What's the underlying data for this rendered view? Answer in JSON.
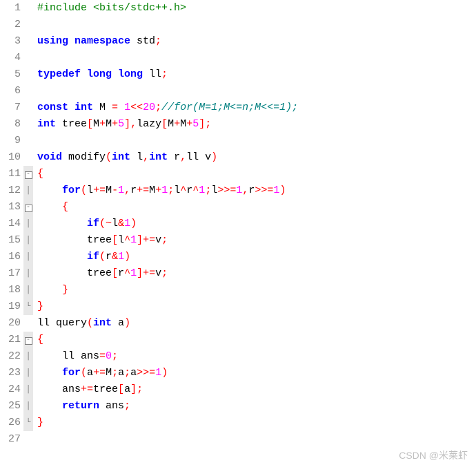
{
  "watermark": "CSDN @米莱虾",
  "lines": [
    {
      "n": 1,
      "fold": "",
      "tokens": [
        [
          "pre",
          "#include <bits/stdc++.h>"
        ]
      ]
    },
    {
      "n": 2,
      "fold": "",
      "tokens": []
    },
    {
      "n": 3,
      "fold": "",
      "tokens": [
        [
          "kw",
          "using namespace"
        ],
        [
          "plain",
          " std"
        ],
        [
          "op",
          ";"
        ]
      ]
    },
    {
      "n": 4,
      "fold": "",
      "tokens": []
    },
    {
      "n": 5,
      "fold": "",
      "tokens": [
        [
          "kw",
          "typedef long long"
        ],
        [
          "plain",
          " ll"
        ],
        [
          "op",
          ";"
        ]
      ]
    },
    {
      "n": 6,
      "fold": "",
      "tokens": []
    },
    {
      "n": 7,
      "fold": "",
      "tokens": [
        [
          "kw",
          "const int"
        ],
        [
          "plain",
          " M "
        ],
        [
          "op",
          "="
        ],
        [
          "plain",
          " "
        ],
        [
          "num",
          "1"
        ],
        [
          "op",
          "<<"
        ],
        [
          "num",
          "20"
        ],
        [
          "op",
          ";"
        ],
        [
          "cmt",
          "//for(M=1;M<=n;M<<=1);"
        ]
      ]
    },
    {
      "n": 8,
      "fold": "",
      "tokens": [
        [
          "kw",
          "int"
        ],
        [
          "plain",
          " tree"
        ],
        [
          "op",
          "["
        ],
        [
          "plain",
          "M"
        ],
        [
          "op",
          "+"
        ],
        [
          "plain",
          "M"
        ],
        [
          "op",
          "+"
        ],
        [
          "num",
          "5"
        ],
        [
          "op",
          "],"
        ],
        [
          "plain",
          "lazy"
        ],
        [
          "op",
          "["
        ],
        [
          "plain",
          "M"
        ],
        [
          "op",
          "+"
        ],
        [
          "plain",
          "M"
        ],
        [
          "op",
          "+"
        ],
        [
          "num",
          "5"
        ],
        [
          "op",
          "];"
        ]
      ]
    },
    {
      "n": 9,
      "fold": "",
      "tokens": []
    },
    {
      "n": 10,
      "fold": "",
      "tokens": [
        [
          "kw",
          "void"
        ],
        [
          "plain",
          " modify"
        ],
        [
          "op",
          "("
        ],
        [
          "kw",
          "int"
        ],
        [
          "plain",
          " l"
        ],
        [
          "op",
          ","
        ],
        [
          "kw",
          "int"
        ],
        [
          "plain",
          " r"
        ],
        [
          "op",
          ","
        ],
        [
          "plain",
          "ll v"
        ],
        [
          "op",
          ")"
        ]
      ]
    },
    {
      "n": 11,
      "fold": "box",
      "tokens": [
        [
          "op",
          "{"
        ]
      ]
    },
    {
      "n": 12,
      "fold": "│",
      "tokens": [
        [
          "plain",
          "    "
        ],
        [
          "kw",
          "for"
        ],
        [
          "op",
          "("
        ],
        [
          "plain",
          "l"
        ],
        [
          "op",
          "+="
        ],
        [
          "plain",
          "M"
        ],
        [
          "op",
          "-"
        ],
        [
          "num",
          "1"
        ],
        [
          "op",
          ","
        ],
        [
          "plain",
          "r"
        ],
        [
          "op",
          "+="
        ],
        [
          "plain",
          "M"
        ],
        [
          "op",
          "+"
        ],
        [
          "num",
          "1"
        ],
        [
          "op",
          ";"
        ],
        [
          "plain",
          "l"
        ],
        [
          "op",
          "^"
        ],
        [
          "plain",
          "r"
        ],
        [
          "op",
          "^"
        ],
        [
          "num",
          "1"
        ],
        [
          "op",
          ";"
        ],
        [
          "plain",
          "l"
        ],
        [
          "op",
          ">>="
        ],
        [
          "num",
          "1"
        ],
        [
          "op",
          ","
        ],
        [
          "plain",
          "r"
        ],
        [
          "op",
          ">>="
        ],
        [
          "num",
          "1"
        ],
        [
          "op",
          ")"
        ]
      ]
    },
    {
      "n": 13,
      "fold": "box",
      "tokens": [
        [
          "plain",
          "    "
        ],
        [
          "op",
          "{"
        ]
      ]
    },
    {
      "n": 14,
      "fold": "│",
      "tokens": [
        [
          "plain",
          "        "
        ],
        [
          "kw",
          "if"
        ],
        [
          "op",
          "(~"
        ],
        [
          "plain",
          "l"
        ],
        [
          "op",
          "&"
        ],
        [
          "num",
          "1"
        ],
        [
          "op",
          ")"
        ]
      ]
    },
    {
      "n": 15,
      "fold": "│",
      "tokens": [
        [
          "plain",
          "        tree"
        ],
        [
          "op",
          "["
        ],
        [
          "plain",
          "l"
        ],
        [
          "op",
          "^"
        ],
        [
          "num",
          "1"
        ],
        [
          "op",
          "]+="
        ],
        [
          "plain",
          "v"
        ],
        [
          "op",
          ";"
        ]
      ]
    },
    {
      "n": 16,
      "fold": "│",
      "tokens": [
        [
          "plain",
          "        "
        ],
        [
          "kw",
          "if"
        ],
        [
          "op",
          "("
        ],
        [
          "plain",
          "r"
        ],
        [
          "op",
          "&"
        ],
        [
          "num",
          "1"
        ],
        [
          "op",
          ")"
        ]
      ]
    },
    {
      "n": 17,
      "fold": "│",
      "tokens": [
        [
          "plain",
          "        tree"
        ],
        [
          "op",
          "["
        ],
        [
          "plain",
          "r"
        ],
        [
          "op",
          "^"
        ],
        [
          "num",
          "1"
        ],
        [
          "op",
          "]+="
        ],
        [
          "plain",
          "v"
        ],
        [
          "op",
          ";"
        ]
      ]
    },
    {
      "n": 18,
      "fold": "│",
      "tokens": [
        [
          "plain",
          "    "
        ],
        [
          "op",
          "}"
        ]
      ]
    },
    {
      "n": 19,
      "fold": "└",
      "tokens": [
        [
          "op",
          "}"
        ]
      ]
    },
    {
      "n": 20,
      "fold": "",
      "tokens": [
        [
          "plain",
          "ll query"
        ],
        [
          "op",
          "("
        ],
        [
          "kw",
          "int"
        ],
        [
          "plain",
          " a"
        ],
        [
          "op",
          ")"
        ]
      ]
    },
    {
      "n": 21,
      "fold": "box",
      "tokens": [
        [
          "op",
          "{"
        ]
      ]
    },
    {
      "n": 22,
      "fold": "│",
      "tokens": [
        [
          "plain",
          "    ll ans"
        ],
        [
          "op",
          "="
        ],
        [
          "num",
          "0"
        ],
        [
          "op",
          ";"
        ]
      ]
    },
    {
      "n": 23,
      "fold": "│",
      "tokens": [
        [
          "plain",
          "    "
        ],
        [
          "kw",
          "for"
        ],
        [
          "op",
          "("
        ],
        [
          "plain",
          "a"
        ],
        [
          "op",
          "+="
        ],
        [
          "plain",
          "M"
        ],
        [
          "op",
          ";"
        ],
        [
          "plain",
          "a"
        ],
        [
          "op",
          ";"
        ],
        [
          "plain",
          "a"
        ],
        [
          "op",
          ">>="
        ],
        [
          "num",
          "1"
        ],
        [
          "op",
          ")"
        ]
      ]
    },
    {
      "n": 24,
      "fold": "│",
      "tokens": [
        [
          "plain",
          "    ans"
        ],
        [
          "op",
          "+="
        ],
        [
          "plain",
          "tree"
        ],
        [
          "op",
          "["
        ],
        [
          "plain",
          "a"
        ],
        [
          "op",
          "];"
        ]
      ]
    },
    {
      "n": 25,
      "fold": "│",
      "tokens": [
        [
          "plain",
          "    "
        ],
        [
          "kw",
          "return"
        ],
        [
          "plain",
          " ans"
        ],
        [
          "op",
          ";"
        ]
      ]
    },
    {
      "n": 26,
      "fold": "└",
      "tokens": [
        [
          "op",
          "}"
        ]
      ]
    },
    {
      "n": 27,
      "fold": "",
      "tokens": []
    }
  ]
}
